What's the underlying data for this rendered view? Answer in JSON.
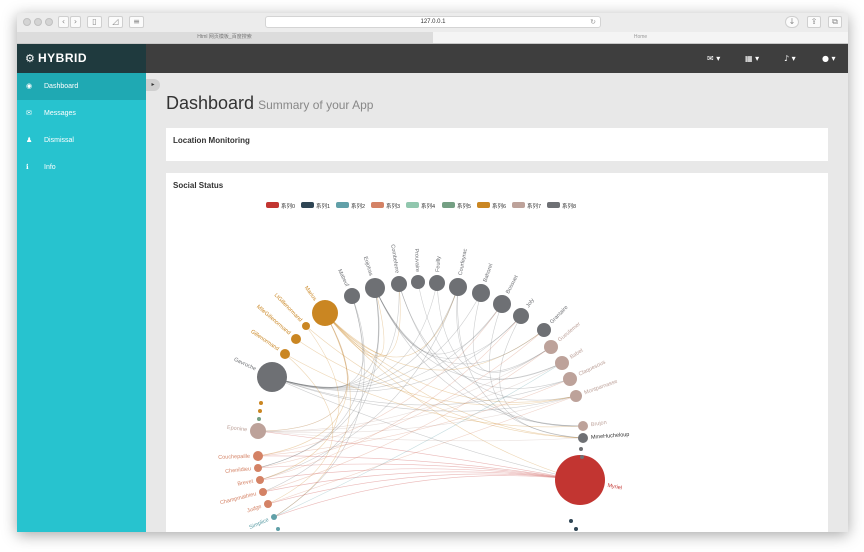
{
  "browser": {
    "url": "127.0.0.1",
    "tabs": [
      {
        "label": "Html 网页模板_百度搜索",
        "active": false
      },
      {
        "label": "Home",
        "active": true
      }
    ]
  },
  "brand": {
    "icon": "gear-icon",
    "name": "HYBRID"
  },
  "topnav": {
    "items": [
      {
        "icon": "envelope-icon",
        "caret": "▾"
      },
      {
        "icon": "grid-icon",
        "caret": "▾"
      },
      {
        "icon": "bell-icon",
        "caret": "▾"
      },
      {
        "icon": "user-icon",
        "caret": "▾"
      }
    ]
  },
  "sidebar": {
    "items": [
      {
        "label": "Dashboard",
        "icon": "dashboard-icon",
        "active": true
      },
      {
        "label": "Messages",
        "icon": "envelope-icon",
        "active": false
      },
      {
        "label": "Dismissal",
        "icon": "user-icon",
        "active": false
      },
      {
        "label": "Info",
        "icon": "info-icon",
        "active": false
      }
    ]
  },
  "page": {
    "title": "Dashboard",
    "subtitle": "Summary of your App"
  },
  "panels": {
    "location": "Location Monitoring",
    "social": "Social Status"
  },
  "colors": {
    "series": [
      "#c23531",
      "#2f4554",
      "#61a0a8",
      "#d48265",
      "#91c7ae",
      "#749f83",
      "#ca8622",
      "#bda29a",
      "#6e7074"
    ]
  },
  "chart_data": {
    "type": "graph",
    "layout": "circular",
    "legend": [
      "系列0",
      "系列1",
      "系列2",
      "系列3",
      "系列4",
      "系列5",
      "系列6",
      "系列7",
      "系列8"
    ],
    "nodes": [
      {
        "name": "Myriel",
        "category": 0
      },
      {
        "name": "MmeHucheloup",
        "category": 8
      },
      {
        "name": "Brujon",
        "category": 7
      },
      {
        "name": "Montparnasse",
        "category": 7
      },
      {
        "name": "Claquesous",
        "category": 7
      },
      {
        "name": "Babet",
        "category": 7
      },
      {
        "name": "Gueulemer",
        "category": 7
      },
      {
        "name": "Grantaire",
        "category": 8
      },
      {
        "name": "Joly",
        "category": 8
      },
      {
        "name": "Bossuet",
        "category": 8
      },
      {
        "name": "Bahorel",
        "category": 8
      },
      {
        "name": "Courfeyrac",
        "category": 8
      },
      {
        "name": "Feuilly",
        "category": 8
      },
      {
        "name": "Prouvaire",
        "category": 8
      },
      {
        "name": "Combeferre",
        "category": 8
      },
      {
        "name": "Enjolras",
        "category": 8
      },
      {
        "name": "Mabeuf",
        "category": 8
      },
      {
        "name": "Marius",
        "category": 6
      },
      {
        "name": "LtGillenormand",
        "category": 6
      },
      {
        "name": "MlleGillenormand",
        "category": 6
      },
      {
        "name": "Gillenormand",
        "category": 6
      },
      {
        "name": "Gavroche",
        "category": 8
      },
      {
        "name": "Eponine",
        "category": 7
      },
      {
        "name": "Couchepaille",
        "category": 3
      },
      {
        "name": "Chenildieu",
        "category": 3
      },
      {
        "name": "Brevet",
        "category": 3
      },
      {
        "name": "Champmathieu",
        "category": 3
      },
      {
        "name": "Judge",
        "category": 3
      },
      {
        "name": "Simplice",
        "category": 2
      }
    ]
  }
}
